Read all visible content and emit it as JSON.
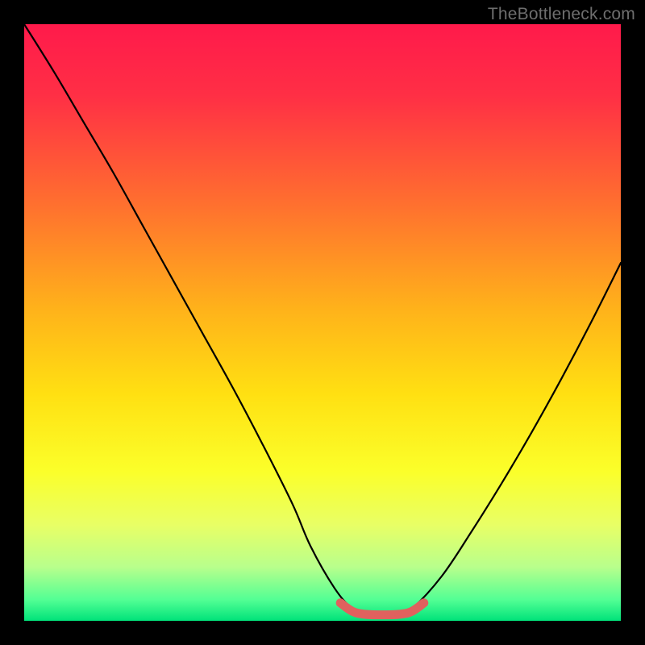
{
  "watermark": "TheBottleneck.com",
  "colors": {
    "background": "#000000",
    "curve": "#000000",
    "notch": "#e0615e",
    "gradient_stops": [
      {
        "offset": 0.0,
        "color": "#ff1a4b"
      },
      {
        "offset": 0.12,
        "color": "#ff2f45"
      },
      {
        "offset": 0.3,
        "color": "#ff6f2f"
      },
      {
        "offset": 0.48,
        "color": "#ffb31a"
      },
      {
        "offset": 0.62,
        "color": "#ffe012"
      },
      {
        "offset": 0.75,
        "color": "#fbff2a"
      },
      {
        "offset": 0.84,
        "color": "#e8ff66"
      },
      {
        "offset": 0.91,
        "color": "#b8ff8c"
      },
      {
        "offset": 0.965,
        "color": "#52ff94"
      },
      {
        "offset": 1.0,
        "color": "#00e27a"
      }
    ]
  },
  "chart_data": {
    "type": "line",
    "title": "",
    "xlabel": "",
    "ylabel": "",
    "xlim": [
      0,
      100
    ],
    "ylim": [
      0,
      100
    ],
    "legend": false,
    "grid": false,
    "series": [
      {
        "name": "bottleneck-curve",
        "x": [
          0,
          5,
          10,
          15,
          20,
          25,
          30,
          35,
          40,
          45,
          48,
          52,
          55,
          57,
          60,
          63,
          65,
          70,
          75,
          80,
          85,
          90,
          95,
          100
        ],
        "y": [
          100,
          92,
          83.5,
          75,
          66,
          57,
          48,
          39,
          29.5,
          19.5,
          12.5,
          5.5,
          2.0,
          1.2,
          1.0,
          1.2,
          2.0,
          7.5,
          15,
          23,
          31.5,
          40.5,
          50,
          60
        ]
      },
      {
        "name": "notch-marker",
        "x": [
          53,
          55,
          57,
          60,
          63,
          65,
          67
        ],
        "y": [
          3.0,
          1.6,
          1.1,
          1.0,
          1.1,
          1.6,
          3.0
        ]
      }
    ],
    "annotations": [
      {
        "text": "TheBottleneck.com",
        "position": "top-right"
      }
    ]
  }
}
